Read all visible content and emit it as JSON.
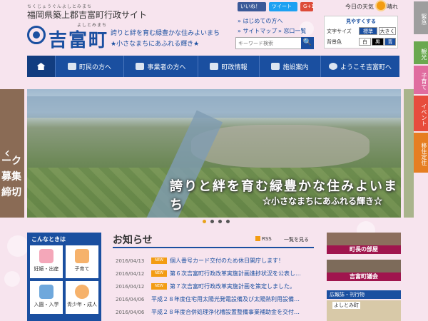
{
  "header": {
    "site_sub": "ちくじょうぐんよしとみまち",
    "site_name": "福岡県築上郡吉富町行政サイト",
    "town_ruby": "よしとみまち",
    "town_name": "吉富町",
    "tagline1": "誇りと絆を育む緑豊かな住みよいまち",
    "tagline2": "★小さなまちにあふれる輝き★",
    "share_fb": "いいね！",
    "share_tw": "ツイート",
    "share_gp": "G+1",
    "weather_label": "今日の天気",
    "weather_value": "晴れ",
    "links": [
      "はじめての方へ",
      "サイトマップ",
      "窓口一覧"
    ],
    "search_placeholder": "キーワード検索",
    "search_button": "🔍"
  },
  "accessibility": {
    "title": "見やすくする",
    "text_size_label": "文字サイズ",
    "text_size_options": [
      "標準",
      "大きく"
    ],
    "bg_label": "背景色",
    "bg_options": [
      "白",
      "黒",
      "青"
    ]
  },
  "side_tabs": [
    {
      "label": "緊急",
      "color": "#9e9e9e"
    },
    {
      "label": "観光",
      "color": "#6aa84f"
    },
    {
      "label": "子育て",
      "color": "#e06c9f"
    },
    {
      "label": "イベント",
      "color": "#e74c3c"
    },
    {
      "label": "移住定住",
      "color": "#e67e22"
    }
  ],
  "nav": {
    "items": [
      "町民の方へ",
      "事業者の方へ",
      "町政情報",
      "施設案内",
      "ようこそ吉富町へ"
    ]
  },
  "hero": {
    "caption1": "誇りと絆を育む緑豊かな住みよいまち",
    "caption2": "☆小さなまちにあふれる輝き☆",
    "prev_text": "ーク\n募集\n締切",
    "prev_arrow": "‹"
  },
  "konna": {
    "title": "こんなときは",
    "tiles": [
      {
        "label": "妊娠・出産",
        "color": "#f4a7b9"
      },
      {
        "label": "子育て",
        "color": "#f6b26b"
      },
      {
        "label": "入園・入学",
        "color": "#6fa8dc"
      },
      {
        "label": "青少年・成人",
        "color": "#f6b26b"
      }
    ]
  },
  "news": {
    "title": "お知らせ",
    "rss": "RSS",
    "more": "一覧を見る",
    "new_badge": "NEW",
    "items": [
      {
        "date": "2016/04/13",
        "new": true,
        "text": "個人番号カード交付のため休日開庁します！"
      },
      {
        "date": "2016/04/12",
        "new": true,
        "text": "第６次吉富町行政改革実施計画進捗状況を公表し…"
      },
      {
        "date": "2016/04/12",
        "new": true,
        "text": "第７次吉富町行政改革実施計画を策定しました。"
      },
      {
        "date": "2016/04/06",
        "new": false,
        "text": "平成２８年度住宅用太陽光発電設備及び太陽熱利用設備…"
      },
      {
        "date": "2016/04/06",
        "new": false,
        "text": "平成２８年度合併処理浄化槽設置整備事業補助金を交付…"
      }
    ]
  },
  "banners": [
    {
      "label": "町長の部屋",
      "color": "#8c6e5d"
    },
    {
      "label": "吉富町議会",
      "color": "#7d6b5a"
    }
  ],
  "kouhou": {
    "title": "広報誌・刊行物",
    "thumb_text": "よしとみ町"
  }
}
